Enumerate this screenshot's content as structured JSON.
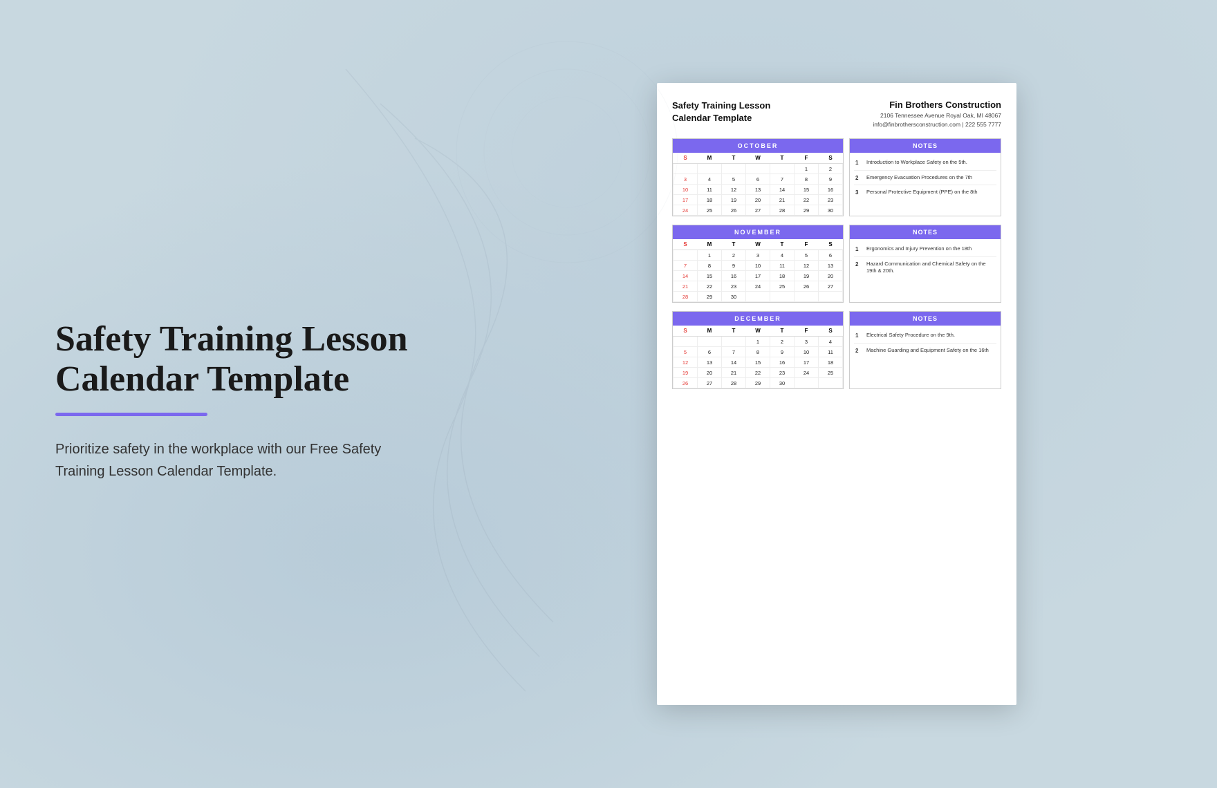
{
  "left": {
    "title_line1": "Safety Training Lesson",
    "title_line2": "Calendar Template",
    "description": "Prioritize safety in the workplace with our Free Safety Training Lesson Calendar Template."
  },
  "document": {
    "title_left_line1": "Safety Training Lesson",
    "title_left_line2": "Calendar Template",
    "company_name": "Fin Brothers Construction",
    "company_address": "2106 Tennessee Avenue Royal Oak, MI 48067",
    "company_contact": "info@finbrothersconstruction.com | 222 555 7777",
    "months": [
      {
        "name": "OCTOBER",
        "days_header": [
          "S",
          "M",
          "T",
          "W",
          "T",
          "F",
          "S"
        ],
        "weeks": [
          [
            "",
            "",
            "",
            "",
            "",
            "1",
            "2"
          ],
          [
            "3",
            "4",
            "5",
            "6",
            "7",
            "8",
            "9"
          ],
          [
            "10",
            "11",
            "12",
            "13",
            "14",
            "15",
            "16"
          ],
          [
            "17",
            "18",
            "19",
            "20",
            "21",
            "22",
            "23"
          ],
          [
            "24",
            "25",
            "26",
            "27",
            "28",
            "29",
            "30"
          ]
        ],
        "red_days": [
          "3",
          "10",
          "17",
          "24"
        ],
        "notes_title": "NOTES",
        "notes": [
          {
            "num": "1",
            "text": "Introduction to Workplace Safety on the 5th."
          },
          {
            "num": "2",
            "text": "Emergency Evacuation Procedures on the 7th"
          },
          {
            "num": "3",
            "text": "Personal Protective Equipment (PPE) on the 8th"
          }
        ]
      },
      {
        "name": "NOVEMBER",
        "days_header": [
          "S",
          "M",
          "T",
          "W",
          "T",
          "F",
          "S"
        ],
        "weeks": [
          [
            "",
            "1",
            "2",
            "3",
            "4",
            "5",
            "6"
          ],
          [
            "7",
            "8",
            "9",
            "10",
            "11",
            "12",
            "13"
          ],
          [
            "14",
            "15",
            "16",
            "17",
            "18",
            "19",
            "20"
          ],
          [
            "21",
            "22",
            "23",
            "24",
            "25",
            "26",
            "27"
          ],
          [
            "28",
            "29",
            "30",
            "",
            "",
            "",
            ""
          ]
        ],
        "red_days": [
          "1",
          "7",
          "14",
          "15",
          "21",
          "22",
          "28",
          "29"
        ],
        "notes_title": "NOTES",
        "notes": [
          {
            "num": "1",
            "text": "Ergonomics and Injury Prevention on the 18th"
          },
          {
            "num": "2",
            "text": "Hazard Communication and Chemical Safety on the 19th & 20th."
          }
        ]
      },
      {
        "name": "DECEMBER",
        "days_header": [
          "S",
          "M",
          "T",
          "W",
          "T",
          "F",
          "S"
        ],
        "weeks": [
          [
            "",
            "",
            "",
            "1",
            "2",
            "3",
            "4"
          ],
          [
            "5",
            "6",
            "7",
            "8",
            "9",
            "10",
            "11"
          ],
          [
            "12",
            "13",
            "14",
            "15",
            "16",
            "17",
            "18"
          ],
          [
            "19",
            "20",
            "21",
            "22",
            "23",
            "24",
            "25"
          ],
          [
            "26",
            "27",
            "28",
            "29",
            "30",
            "",
            ""
          ]
        ],
        "red_days": [
          "5",
          "12",
          "19",
          "26"
        ],
        "notes_title": "NOTES",
        "notes": [
          {
            "num": "1",
            "text": "Electrical Safety Procedure on the 9th."
          },
          {
            "num": "2",
            "text": "Machine Guarding and Equipment Safety on the 16th"
          }
        ]
      }
    ]
  }
}
